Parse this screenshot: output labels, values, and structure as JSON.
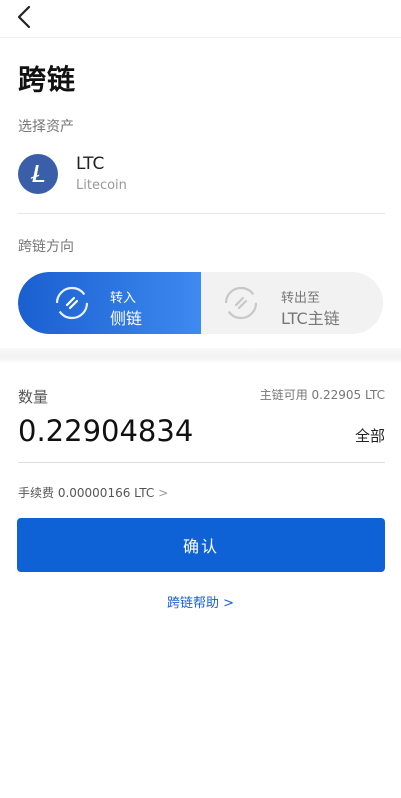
{
  "page": {
    "title": "跨链"
  },
  "asset": {
    "section_label": "选择资产",
    "symbol": "LTC",
    "name": "Litecoin",
    "logo_color": "#3a5fa8"
  },
  "direction": {
    "section_label": "跨链方向",
    "options": [
      {
        "line1": "转入",
        "line2": "侧链",
        "selected": true
      },
      {
        "line1": "转出至",
        "line2": "LTC主链",
        "selected": false
      }
    ],
    "accent": "#1a5fd0"
  },
  "quantity": {
    "label": "数量",
    "available": "主链可用 0.22905 LTC",
    "value": "0.22904834",
    "all_label": "全部"
  },
  "fee": {
    "text": "手续费 0.00000166 LTC",
    "chevron": ">"
  },
  "confirm_label": "确认",
  "help_label": "跨链帮助 >"
}
